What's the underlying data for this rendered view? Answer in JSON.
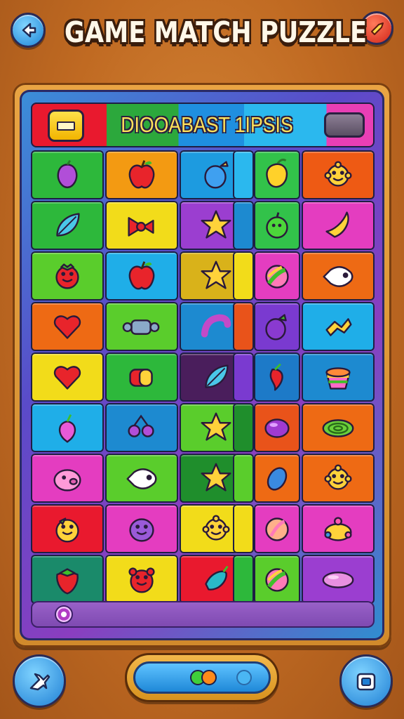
{
  "title": "GAME MATCH PUZZLE",
  "header": {
    "text": "DIOOABAST 1IPSIS"
  },
  "colors": {
    "frame": "#e9a443",
    "panel": "#5a4bc9",
    "title_text": "#fff7e8",
    "header_text": "#ffe25a"
  },
  "board": {
    "rows": 9,
    "columns": 6,
    "tiles": [
      {
        "color": "#2db83b",
        "icon": "plum-icon"
      },
      {
        "color": "#f39a12",
        "icon": "apple-icon"
      },
      {
        "color": "#1d9be0",
        "icon": "blue-fruit-icon"
      },
      {
        "color": "#32c24a",
        "icon": "mango-icon"
      },
      {
        "color": "#ee5a14",
        "icon": "sun-face-icon"
      },
      {
        "color": "#2db83b",
        "icon": "leaf-icon"
      },
      {
        "color": "#f2dc1a",
        "icon": "bow-candy-icon"
      },
      {
        "color": "#9b3ed0",
        "icon": "star-icon"
      },
      {
        "color": "#32c24a",
        "icon": "green-fruit-icon"
      },
      {
        "color": "#e43dc0",
        "icon": "banana-icon"
      },
      {
        "color": "#5acd2c",
        "icon": "tomato-face-icon"
      },
      {
        "color": "#1faee8",
        "icon": "apple-icon"
      },
      {
        "color": "#d9b21a",
        "icon": "star-icon"
      },
      {
        "color": "#e43dc0",
        "icon": "striped-ball-icon"
      },
      {
        "color": "#ee6a14",
        "icon": "fish-icon"
      },
      {
        "color": "#ee6a14",
        "icon": "heart-icon"
      },
      {
        "color": "#5acd2c",
        "icon": "wrapped-candy-icon"
      },
      {
        "color": "#1d8ad0",
        "icon": "worm-icon"
      },
      {
        "color": "#7a3ad0",
        "icon": "eggplant-icon"
      },
      {
        "color": "#1faee8",
        "icon": "bone-icon"
      },
      {
        "color": "#f2dc1a",
        "icon": "heart-icon"
      },
      {
        "color": "#2db83b",
        "icon": "candy-roll-icon"
      },
      {
        "color": "#4a1e5c",
        "icon": "leaf-icon"
      },
      {
        "color": "#1d7ac8",
        "icon": "chili-icon"
      },
      {
        "color": "#1d8ad0",
        "icon": "rainbow-cup-icon"
      },
      {
        "color": "#1faee8",
        "icon": "radish-icon"
      },
      {
        "color": "#1d8ad0",
        "icon": "cherry-icon"
      },
      {
        "color": "#5acd2c",
        "icon": "star-icon"
      },
      {
        "color": "#e9531a",
        "icon": "purple-bean-icon"
      },
      {
        "color": "#ee6a14",
        "icon": "swirl-icon"
      },
      {
        "color": "#e43dc0",
        "icon": "pig-icon"
      },
      {
        "color": "#5acd2c",
        "icon": "fish-icon"
      },
      {
        "color": "#1f8e2c",
        "icon": "star-icon"
      },
      {
        "color": "#ee6a14",
        "icon": "blue-egg-icon"
      },
      {
        "color": "#ee6a14",
        "icon": "sun-face-icon"
      },
      {
        "color": "#e9192e",
        "icon": "smile-fruit-icon"
      },
      {
        "color": "#e43dc0",
        "icon": "purple-blob-icon"
      },
      {
        "color": "#f2dc1a",
        "icon": "sun-face-icon"
      },
      {
        "color": "#e43dc0",
        "icon": "peach-ball-icon"
      },
      {
        "color": "#e43dc0",
        "icon": "yellow-crown-icon"
      },
      {
        "color": "#1a8a6a",
        "icon": "strawberry-icon"
      },
      {
        "color": "#f2dc1a",
        "icon": "red-face-icon"
      },
      {
        "color": "#e9192e",
        "icon": "teal-fruit-icon"
      },
      {
        "color": "#5acd2c",
        "icon": "striped-ball-icon"
      },
      {
        "color": "#9b3ed0",
        "icon": "pink-pill-icon"
      }
    ]
  }
}
